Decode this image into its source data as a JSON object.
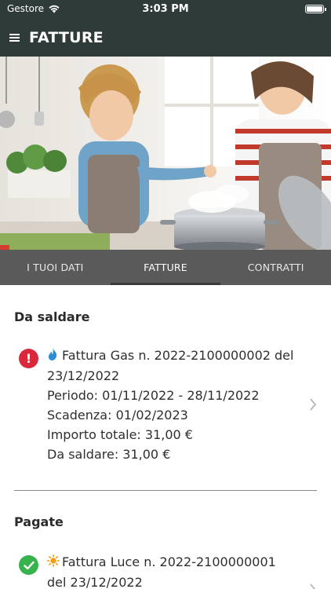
{
  "status_bar": {
    "carrier": "Gestore",
    "time": "3:03 PM"
  },
  "header": {
    "title": "FATTURE",
    "menu_icon": "hamburger-menu-icon"
  },
  "hero": {
    "icon": "photo-kitchen-family"
  },
  "tabs": [
    {
      "label": "I TUOI DATI",
      "active": false
    },
    {
      "label": "FATTURE",
      "active": true
    },
    {
      "label": "CONTRATTI",
      "active": false
    }
  ],
  "sections": {
    "unpaid": {
      "title": "Da saldare",
      "invoice": {
        "status_icon": "alert-icon",
        "type_icon": "gas-flame-icon",
        "line1": "Fattura Gas n. 2022-2100000002 del",
        "line2": "23/12/2022",
        "period": "Periodo: 01/11/2022 - 28/11/2022",
        "due": "Scadenza: 01/02/2023",
        "total": "Importo totale: 31,00 €",
        "balance": "Da saldare: 31,00 €"
      }
    },
    "paid": {
      "title": "Pagate",
      "invoice": {
        "status_icon": "check-icon",
        "type_icon": "sun-electricity-icon",
        "line1": "Fattura Luce n. 2022-2100000001",
        "line2": "del 23/12/2022"
      }
    }
  },
  "colors": {
    "header_bg": "#2f3b38",
    "tabs_bg": "#5a5a5a",
    "alert": "#d9283c",
    "paid": "#37b24d",
    "gas": "#2a8fd6",
    "electricity": "#f39c12"
  }
}
